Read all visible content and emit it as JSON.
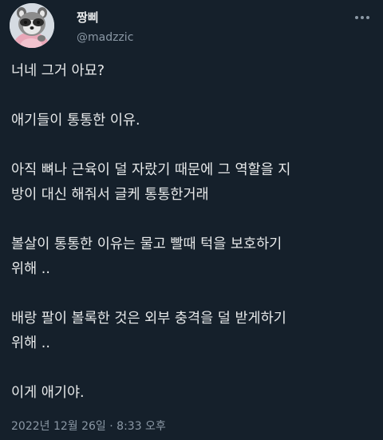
{
  "author": {
    "display_name": "짱삐",
    "handle": "@madzzic",
    "avatar_icon": "raccoon-avatar"
  },
  "icons": {
    "more": "more-options-icon"
  },
  "tweet_lines": [
    "너네 그거 아묘?",
    "",
    "애기들이 통통한 이유.",
    "",
    "아직 뼈나 근육이 덜 자랐기 때문에 그 역할을 지",
    "방이 대신 해줘서 글케 통통한거래",
    "",
    "볼살이 통통한 이유는 물고 빨때 턱을 보호하기",
    "위해 ..",
    "",
    "배랑 팔이 볼록한 것은 외부 충격을 덜 받게하기",
    "위해 ..",
    "",
    "이게 애기야."
  ],
  "timestamp": {
    "date": "2022년 12월 26일",
    "separator": "·",
    "time": "8:33 오후"
  },
  "colors": {
    "background": "#15202b",
    "text": "#e7e9ea",
    "secondary_text": "#8b98a5"
  }
}
